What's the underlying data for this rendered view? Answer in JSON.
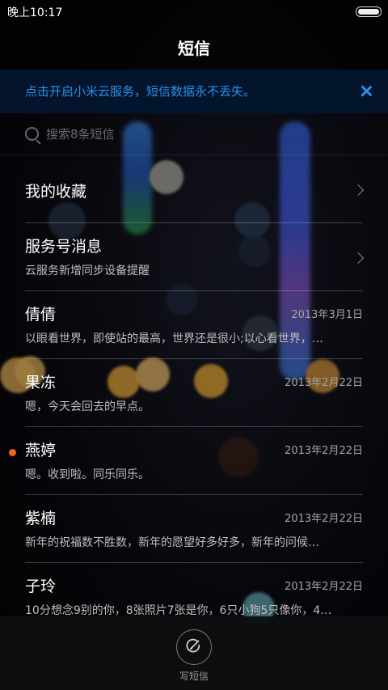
{
  "status_bar": {
    "time": "晚上10:17",
    "battery_icon": "battery-icon"
  },
  "header": {
    "title": "短信"
  },
  "banner": {
    "text": "点击开启小米云服务，短信数据永不丢失。",
    "close_icon": "close-icon",
    "accent": "#2b8fe6"
  },
  "search": {
    "placeholder": "搜索8条短信",
    "icon": "search-icon"
  },
  "conversations": [
    {
      "name": "我的收藏",
      "preview": "",
      "date": "",
      "has_chevron": true,
      "unread": false
    },
    {
      "name": "服务号消息",
      "preview": "云服务新增同步设备提醒",
      "date": "",
      "has_chevron": true,
      "unread": false
    },
    {
      "name": "倩倩",
      "preview": "以眼看世界，即使站的最高，世界还是很小;以心看世界，…",
      "date": "2013年3月1日",
      "unread": false
    },
    {
      "name": "果冻",
      "preview": "嗯，今天会回去的早点。",
      "date": "2013年2月22日",
      "unread": false
    },
    {
      "name": "燕婷",
      "preview": "嗯。收到啦。同乐同乐。",
      "date": "2013年2月22日",
      "unread": true
    },
    {
      "name": "紫楠",
      "preview": "新年的祝福数不胜数，新年的愿望好多好多，新年的问候…",
      "date": "2013年2月22日",
      "unread": false
    },
    {
      "name": "子玲",
      "preview": "10分想念9别的你，8张照片7张是你，6只小狗5只像你，4…",
      "date": "2013年2月22日",
      "unread": false
    }
  ],
  "bottom_bar": {
    "compose_label": "写短信",
    "compose_icon": "compose-icon"
  },
  "colors": {
    "unread_dot": "#f0631c",
    "background": "#07070c"
  }
}
